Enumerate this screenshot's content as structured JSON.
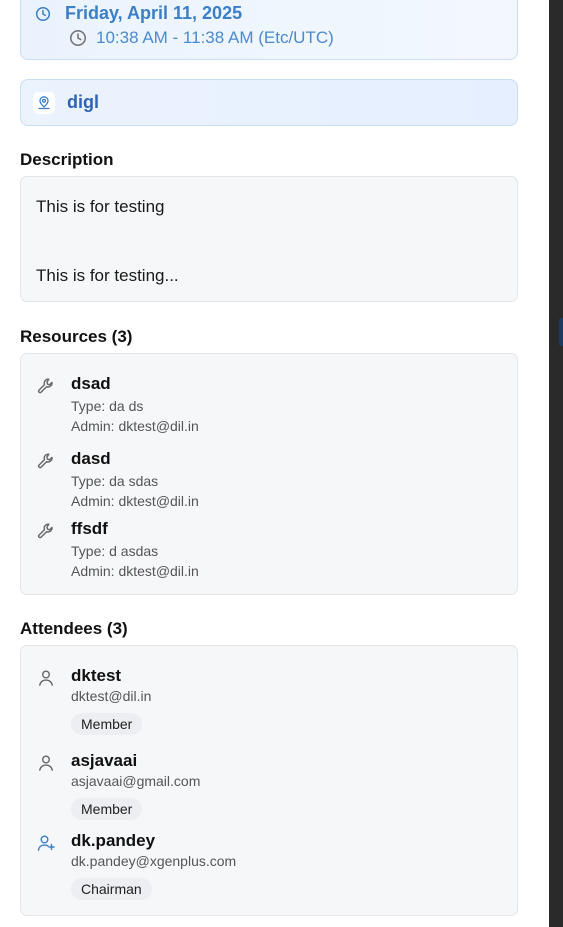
{
  "event": {
    "date": "Friday, April 11, 2025",
    "time": "10:38 AM - 11:38 AM (Etc/UTC)",
    "location": "digl"
  },
  "description": {
    "title": "Description",
    "lines": [
      "This is for testing",
      "This is for testing..."
    ]
  },
  "resources": {
    "title": "Resources (3)",
    "items": [
      {
        "name": "dsad",
        "type": "Type: da ds",
        "admin": "Admin: dktest@dil.in"
      },
      {
        "name": "dasd",
        "type": "Type: da sdas",
        "admin": "Admin: dktest@dil.in"
      },
      {
        "name": "ffsdf",
        "type": "Type: d asdas",
        "admin": "Admin: dktest@dil.in"
      }
    ]
  },
  "attendees": {
    "title": "Attendees (3)",
    "items": [
      {
        "name": "dktest",
        "email": "dktest@dil.in",
        "role": "Member",
        "icon": "user-icon"
      },
      {
        "name": "asjavaai",
        "email": "asjavaai@gmail.com",
        "role": "Member",
        "icon": "user-icon"
      },
      {
        "name": "dk.pandey",
        "email": "dk.pandey@xgenplus.com",
        "role": "Chairman",
        "icon": "user-plus-icon"
      }
    ]
  },
  "colors": {
    "accent": "#3a7fc8",
    "location_text": "#2e64b8",
    "panel_bg": "#f6f7f9"
  }
}
